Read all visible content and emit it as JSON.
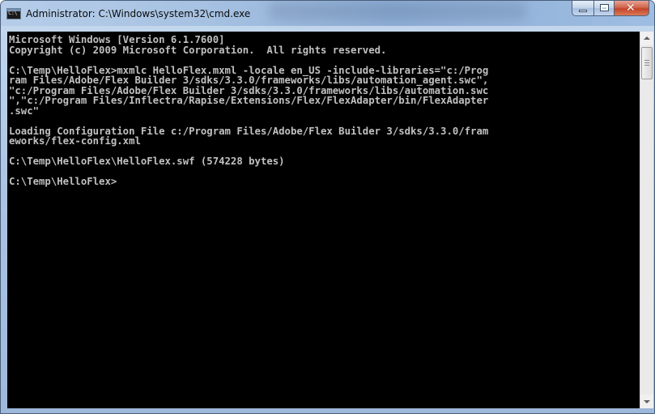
{
  "window": {
    "title": "Administrator: C:\\Windows\\system32\\cmd.exe",
    "icon_text": "C:\\",
    "controls": {
      "minimize": "minimize-icon",
      "maximize": "maximize-icon",
      "close": "close-icon",
      "close_glyph": "✕"
    }
  },
  "console": {
    "lines": [
      "Microsoft Windows [Version 6.1.7600]",
      "Copyright (c) 2009 Microsoft Corporation.  All rights reserved.",
      "",
      "C:\\Temp\\HelloFlex>mxmlc HelloFlex.mxml -locale en_US -include-libraries=\"c:/Prog",
      "ram Files/Adobe/Flex Builder 3/sdks/3.3.0/frameworks/libs/automation_agent.swc\",",
      "\"c:/Program Files/Adobe/Flex Builder 3/sdks/3.3.0/frameworks/libs/automation.swc",
      "\",\"c:/Program Files/Inflectra/Rapise/Extensions/Flex/FlexAdapter/bin/FlexAdapter",
      ".swc\"",
      "",
      "Loading Configuration File c:/Program Files/Adobe/Flex Builder 3/sdks/3.3.0/fram",
      "eworks/flex-config.xml",
      "",
      "C:\\Temp\\HelloFlex\\HelloFlex.swf (574228 bytes)",
      "",
      "C:\\Temp\\HelloFlex>"
    ]
  },
  "colors": {
    "console_bg": "#000000",
    "console_fg": "#c0c0c0",
    "close_button": "#c3442a"
  }
}
